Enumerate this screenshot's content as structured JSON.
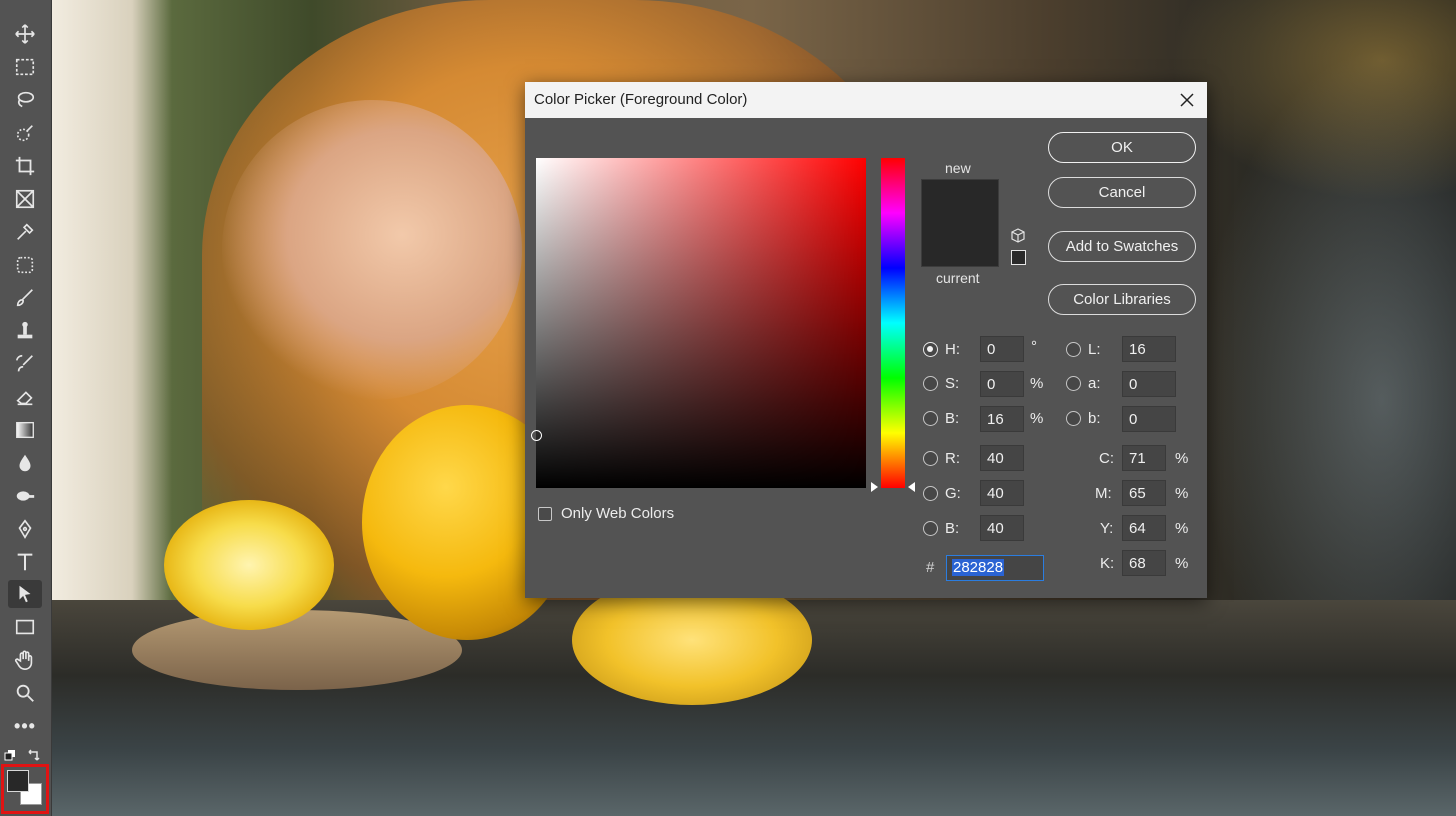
{
  "dialog": {
    "title": "Color Picker (Foreground Color)",
    "buttons": {
      "ok": "OK",
      "cancel": "Cancel",
      "add_swatches": "Add to Swatches",
      "libraries": "Color Libraries"
    },
    "preview": {
      "new_label": "new",
      "current_label": "current",
      "color": "#282828"
    },
    "only_web_colors_label": "Only Web Colors",
    "only_web_colors_checked": false,
    "selected_mode": "H",
    "hsb": {
      "h": {
        "label": "H:",
        "value": "0",
        "unit": "°"
      },
      "s": {
        "label": "S:",
        "value": "0",
        "unit": "%"
      },
      "b": {
        "label": "B:",
        "value": "16",
        "unit": "%"
      }
    },
    "rgb": {
      "r": {
        "label": "R:",
        "value": "40"
      },
      "g": {
        "label": "G:",
        "value": "40"
      },
      "b": {
        "label": "B:",
        "value": "40"
      }
    },
    "lab": {
      "l": {
        "label": "L:",
        "value": "16"
      },
      "a": {
        "label": "a:",
        "value": "0"
      },
      "b": {
        "label": "b:",
        "value": "0"
      }
    },
    "cmyk": {
      "c": {
        "label": "C:",
        "value": "71",
        "unit": "%"
      },
      "m": {
        "label": "M:",
        "value": "65",
        "unit": "%"
      },
      "y": {
        "label": "Y:",
        "value": "64",
        "unit": "%"
      },
      "k": {
        "label": "K:",
        "value": "68",
        "unit": "%"
      }
    },
    "hex": {
      "hash": "#",
      "value": "282828"
    },
    "hue_color": "#ff0000"
  },
  "toolbar": {
    "tools": [
      "move-tool",
      "marquee-tool",
      "lasso-tool",
      "quick-selection-tool",
      "crop-tool",
      "frame-tool",
      "eyedropper-tool",
      "spot-healing-tool",
      "brush-tool",
      "clone-stamp-tool",
      "history-brush-tool",
      "eraser-tool",
      "gradient-tool",
      "blur-tool",
      "dodge-tool",
      "pen-tool",
      "type-tool",
      "path-selection-tool",
      "rectangle-tool",
      "hand-tool",
      "zoom-tool"
    ],
    "active_tool": "path-selection-tool",
    "more_label": "•••",
    "foreground_color": "#282828",
    "background_color": "#ffffff"
  }
}
